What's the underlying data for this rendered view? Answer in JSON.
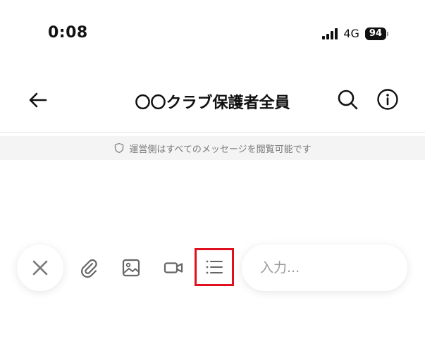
{
  "status_bar": {
    "time": "0:08",
    "network": "4G",
    "battery": "94"
  },
  "header": {
    "title": "〇〇クラブ保護者全員",
    "back_icon": "arrow-left-icon",
    "search_icon": "search-icon",
    "info_icon": "info-icon"
  },
  "notice": {
    "text": "運営側はすべてのメッセージを閲覧可能です",
    "icon": "shield-icon"
  },
  "toolbar": {
    "close_icon": "close-icon",
    "attach_icon": "paperclip-icon",
    "image_icon": "image-icon",
    "video_icon": "video-camera-icon",
    "list_icon": "list-icon",
    "highlight_color": "#e0111f"
  },
  "input": {
    "placeholder": "入力...",
    "value": ""
  }
}
